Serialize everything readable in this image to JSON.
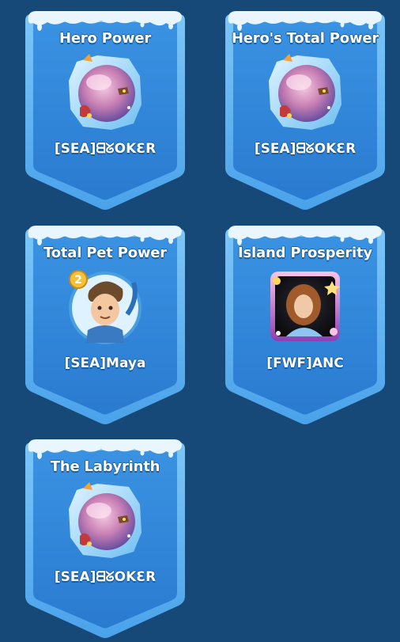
{
  "colors": {
    "background": "#164978",
    "banner_outer": "#5fb4f1",
    "banner_inner": "#2f87dc",
    "snow": "#eaf6ff"
  },
  "cards": [
    {
      "title": "Hero Power",
      "player": "[SEA]ᗺᘜOKƐR",
      "avatar": "crystal-orb-avatar-icon"
    },
    {
      "title": "Hero's Total Power",
      "player": "[SEA]ᗺᘜOKƐR",
      "avatar": "crystal-orb-avatar-icon"
    },
    {
      "title": "Total Pet Power",
      "player": "[SEA]Maya",
      "avatar": "hero-boy-avatar-icon"
    },
    {
      "title": "Island Prosperity",
      "player": "[FWF]ANC",
      "avatar": "portrait-photo-avatar-icon"
    },
    {
      "title": "The Labyrinth",
      "player": "[SEA]ᗺᘜOKƐR",
      "avatar": "crystal-orb-avatar-icon"
    }
  ]
}
